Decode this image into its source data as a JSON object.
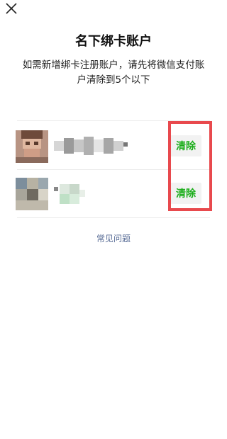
{
  "header": {
    "close_icon": "close-icon",
    "title": "名下绑卡账户"
  },
  "description": "如需新增绑卡注册账户，请先将微信支付账户清除到5个以下",
  "accounts": [
    {
      "avatar": "avatar-blurred",
      "clear_label": "清除"
    },
    {
      "avatar": "avatar-blurred",
      "clear_label": "清除"
    }
  ],
  "faq_link": "常见问题",
  "colors": {
    "accent_green": "#1aad19",
    "highlight_red": "#e8494d",
    "link_blue": "#576b95"
  }
}
